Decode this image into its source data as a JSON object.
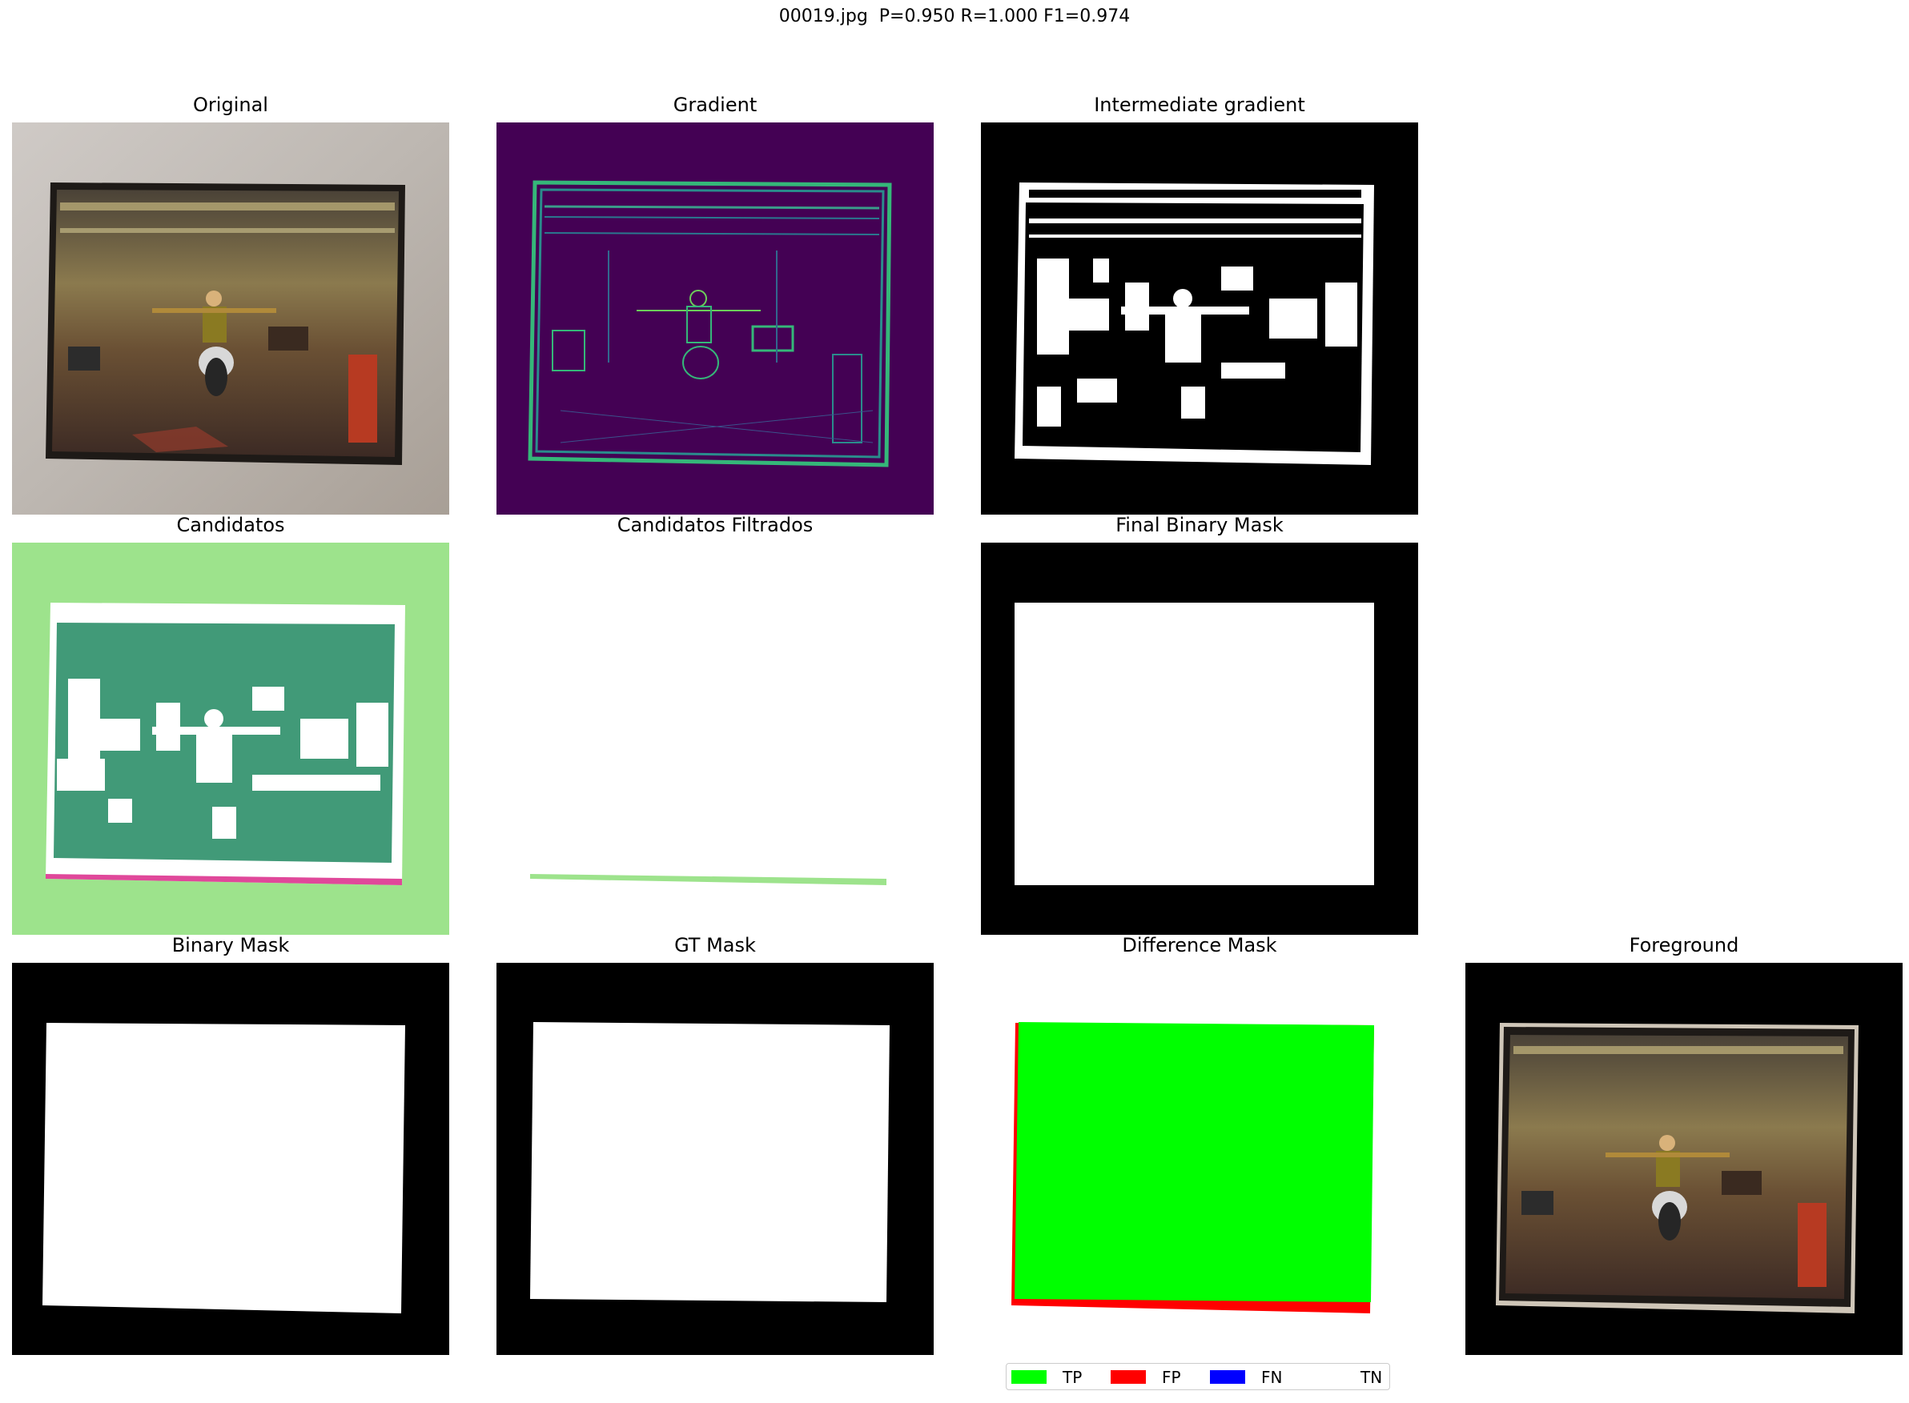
{
  "figure_title": "00019.jpg  P=0.950 R=1.000 F1=0.974",
  "panels": {
    "original": {
      "title": "Original"
    },
    "gradient": {
      "title": "Gradient"
    },
    "intermediate": {
      "title": "Intermediate gradient"
    },
    "candidatos": {
      "title": "Candidatos"
    },
    "filtrados": {
      "title": "Candidatos Filtrados"
    },
    "final": {
      "title": "Final Binary Mask"
    },
    "binary": {
      "title": "Binary Mask"
    },
    "gt": {
      "title": "GT Mask"
    },
    "difference": {
      "title": "Difference Mask"
    },
    "foreground": {
      "title": "Foreground"
    }
  },
  "legend": {
    "items": [
      {
        "label": "TP",
        "color": "#00ff00"
      },
      {
        "label": "FP",
        "color": "#ff0000"
      },
      {
        "label": "FN",
        "color": "#0000ff"
      },
      {
        "label": "TN",
        "color": "#ffffff"
      }
    ]
  },
  "colors": {
    "background_mask": "#000000",
    "foreground_mask": "#ffffff",
    "candidate_bg": "#9de38c",
    "candidate_region": "#419a78",
    "candidate_pink": "#e0489a",
    "gradient_bg": "#440154",
    "gradient_edge": "#35b779"
  }
}
